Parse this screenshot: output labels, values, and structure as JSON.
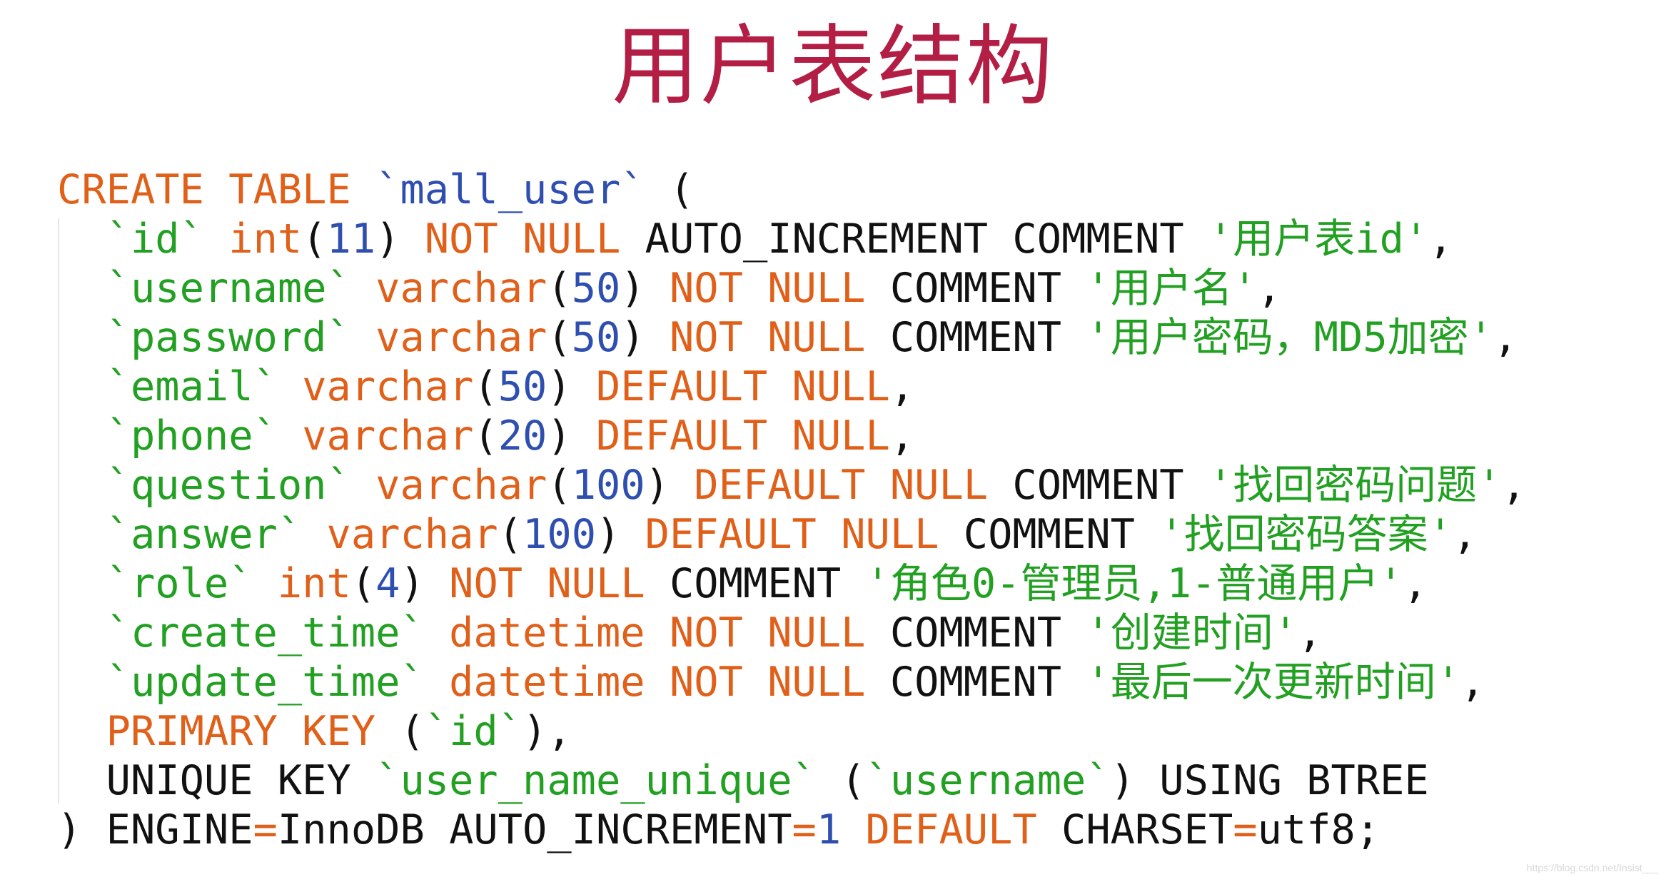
{
  "title": "用户表结构",
  "watermark": "https://blog.csdn.net/Insist___",
  "colors": {
    "title": "#b31e45",
    "keyword": "#e0601a",
    "identifier": "#22a022",
    "string": "#22a022",
    "number": "#2f4fb0",
    "table_name": "#2f4fb0",
    "plain": "#111111"
  },
  "code_lines": [
    [
      [
        "kw",
        "CREATE TABLE"
      ],
      [
        "pl",
        " "
      ],
      [
        "tbl",
        "`mall_user`"
      ],
      [
        "pl",
        " ("
      ]
    ],
    [
      [
        "pl",
        "  "
      ],
      [
        "id",
        "`id`"
      ],
      [
        "pl",
        " "
      ],
      [
        "kw",
        "int"
      ],
      [
        "pl",
        "("
      ],
      [
        "num",
        "11"
      ],
      [
        "pl",
        ") "
      ],
      [
        "kw",
        "NOT NULL"
      ],
      [
        "pl",
        " AUTO_INCREMENT COMMENT "
      ],
      [
        "str",
        "'用户表id'"
      ],
      [
        "pl",
        ","
      ]
    ],
    [
      [
        "pl",
        "  "
      ],
      [
        "id",
        "`username`"
      ],
      [
        "pl",
        " "
      ],
      [
        "kw",
        "varchar"
      ],
      [
        "pl",
        "("
      ],
      [
        "num",
        "50"
      ],
      [
        "pl",
        ") "
      ],
      [
        "kw",
        "NOT NULL"
      ],
      [
        "pl",
        " COMMENT "
      ],
      [
        "str",
        "'用户名'"
      ],
      [
        "pl",
        ","
      ]
    ],
    [
      [
        "pl",
        "  "
      ],
      [
        "id",
        "`password`"
      ],
      [
        "pl",
        " "
      ],
      [
        "kw",
        "varchar"
      ],
      [
        "pl",
        "("
      ],
      [
        "num",
        "50"
      ],
      [
        "pl",
        ") "
      ],
      [
        "kw",
        "NOT NULL"
      ],
      [
        "pl",
        " COMMENT "
      ],
      [
        "str",
        "'用户密码，MD5加密'"
      ],
      [
        "pl",
        ","
      ]
    ],
    [
      [
        "pl",
        "  "
      ],
      [
        "id",
        "`email`"
      ],
      [
        "pl",
        " "
      ],
      [
        "kw",
        "varchar"
      ],
      [
        "pl",
        "("
      ],
      [
        "num",
        "50"
      ],
      [
        "pl",
        ") "
      ],
      [
        "kw",
        "DEFAULT NULL"
      ],
      [
        "pl",
        ","
      ]
    ],
    [
      [
        "pl",
        "  "
      ],
      [
        "id",
        "`phone`"
      ],
      [
        "pl",
        " "
      ],
      [
        "kw",
        "varchar"
      ],
      [
        "pl",
        "("
      ],
      [
        "num",
        "20"
      ],
      [
        "pl",
        ") "
      ],
      [
        "kw",
        "DEFAULT NULL"
      ],
      [
        "pl",
        ","
      ]
    ],
    [
      [
        "pl",
        "  "
      ],
      [
        "id",
        "`question`"
      ],
      [
        "pl",
        " "
      ],
      [
        "kw",
        "varchar"
      ],
      [
        "pl",
        "("
      ],
      [
        "num",
        "100"
      ],
      [
        "pl",
        ") "
      ],
      [
        "kw",
        "DEFAULT NULL"
      ],
      [
        "pl",
        " COMMENT "
      ],
      [
        "str",
        "'找回密码问题'"
      ],
      [
        "pl",
        ","
      ]
    ],
    [
      [
        "pl",
        "  "
      ],
      [
        "id",
        "`answer`"
      ],
      [
        "pl",
        " "
      ],
      [
        "kw",
        "varchar"
      ],
      [
        "pl",
        "("
      ],
      [
        "num",
        "100"
      ],
      [
        "pl",
        ") "
      ],
      [
        "kw",
        "DEFAULT NULL"
      ],
      [
        "pl",
        " COMMENT "
      ],
      [
        "str",
        "'找回密码答案'"
      ],
      [
        "pl",
        ","
      ]
    ],
    [
      [
        "pl",
        "  "
      ],
      [
        "id",
        "`role`"
      ],
      [
        "pl",
        " "
      ],
      [
        "kw",
        "int"
      ],
      [
        "pl",
        "("
      ],
      [
        "num",
        "4"
      ],
      [
        "pl",
        ") "
      ],
      [
        "kw",
        "NOT NULL"
      ],
      [
        "pl",
        " COMMENT "
      ],
      [
        "str",
        "'角色0-管理员,1-普通用户'"
      ],
      [
        "pl",
        ","
      ]
    ],
    [
      [
        "pl",
        "  "
      ],
      [
        "id",
        "`create_time`"
      ],
      [
        "pl",
        " "
      ],
      [
        "kw",
        "datetime"
      ],
      [
        "pl",
        " "
      ],
      [
        "kw",
        "NOT NULL"
      ],
      [
        "pl",
        " COMMENT "
      ],
      [
        "str",
        "'创建时间'"
      ],
      [
        "pl",
        ","
      ]
    ],
    [
      [
        "pl",
        "  "
      ],
      [
        "id",
        "`update_time`"
      ],
      [
        "pl",
        " "
      ],
      [
        "kw",
        "datetime"
      ],
      [
        "pl",
        " "
      ],
      [
        "kw",
        "NOT NULL"
      ],
      [
        "pl",
        " COMMENT "
      ],
      [
        "str",
        "'最后一次更新时间'"
      ],
      [
        "pl",
        ","
      ]
    ],
    [
      [
        "pl",
        "  "
      ],
      [
        "kw",
        "PRIMARY KEY"
      ],
      [
        "pl",
        " ("
      ],
      [
        "id",
        "`id`"
      ],
      [
        "pl",
        "),"
      ]
    ],
    [
      [
        "pl",
        "  UNIQUE KEY "
      ],
      [
        "id",
        "`user_name_unique`"
      ],
      [
        "pl",
        " ("
      ],
      [
        "id",
        "`username`"
      ],
      [
        "pl",
        ") USING BTREE"
      ]
    ],
    [
      [
        "pl",
        ") ENGINE"
      ],
      [
        "op",
        "="
      ],
      [
        "pl",
        "InnoDB AUTO_INCREMENT"
      ],
      [
        "op",
        "="
      ],
      [
        "num",
        "1"
      ],
      [
        "pl",
        " "
      ],
      [
        "kw",
        "DEFAULT"
      ],
      [
        "pl",
        " CHARSET"
      ],
      [
        "op",
        "="
      ],
      [
        "pl",
        "utf8;"
      ]
    ]
  ]
}
